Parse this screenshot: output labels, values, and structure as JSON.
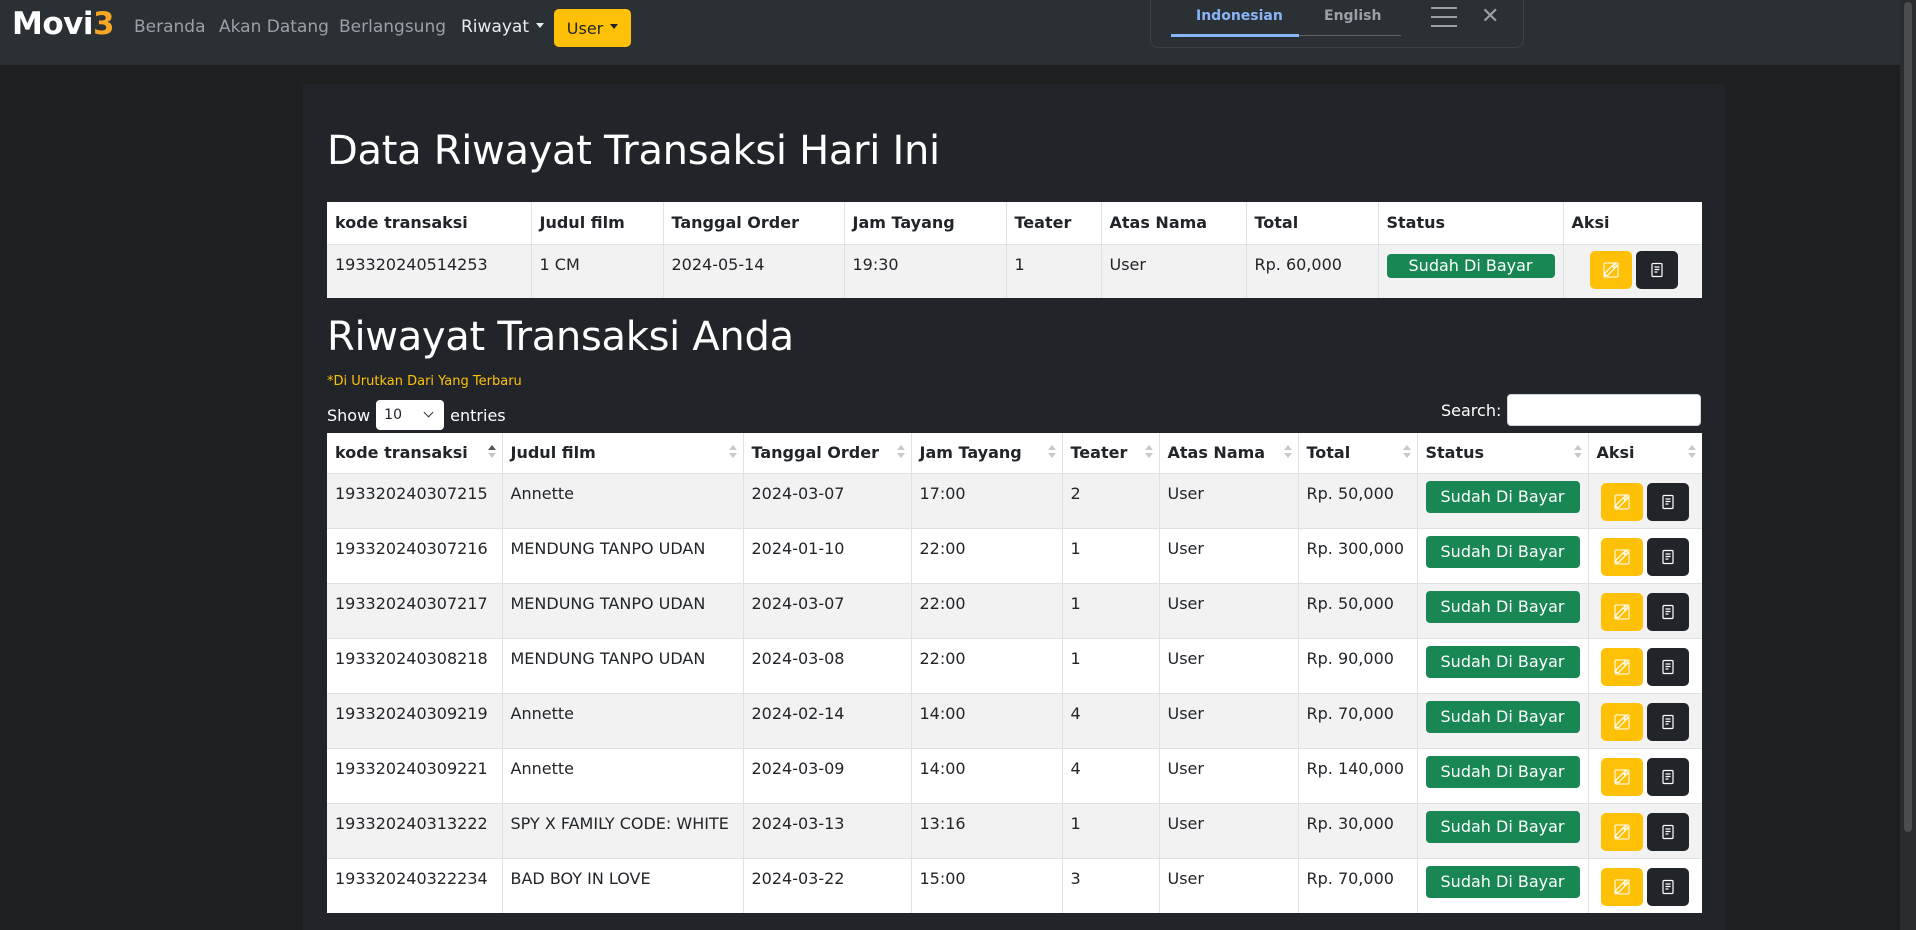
{
  "brand": {
    "name": "Movi",
    "accent": "3"
  },
  "nav": {
    "beranda": "Beranda",
    "akan_datang": "Akan Datang",
    "berlangsung": "Berlangsung",
    "riwayat": "Riwayat",
    "user": "User"
  },
  "lang": {
    "indonesian": "Indonesian",
    "english": "English"
  },
  "today": {
    "title": "Data Riwayat Transaksi Hari Ini",
    "headers": [
      "kode transaksi",
      "Judul film",
      "Tanggal Order",
      "Jam Tayang",
      "Teater",
      "Atas Nama",
      "Total",
      "Status",
      "Aksi"
    ],
    "rows": [
      [
        "193320240514253",
        "1 CM",
        "2024-05-14",
        "19:30",
        "1",
        "User",
        "Rp. 60,000",
        "Sudah Di Bayar"
      ]
    ]
  },
  "history": {
    "title": "Riwayat Transaksi Anda",
    "note": "*Di Urutkan Dari Yang Terbaru",
    "show_label": "Show",
    "entries_value": "10",
    "entries_label": "entries",
    "search_label": "Search:",
    "headers": [
      "kode transaksi",
      "Judul film",
      "Tanggal Order",
      "Jam Tayang",
      "Teater",
      "Atas Nama",
      "Total",
      "Status",
      "Aksi"
    ],
    "rows": [
      [
        "193320240307215",
        "Annette",
        "2024-03-07",
        "17:00",
        "2",
        "User",
        "Rp. 50,000",
        "Sudah Di Bayar"
      ],
      [
        "193320240307216",
        "MENDUNG TANPO UDAN",
        "2024-01-10",
        "22:00",
        "1",
        "User",
        "Rp. 300,000",
        "Sudah Di Bayar"
      ],
      [
        "193320240307217",
        "MENDUNG TANPO UDAN",
        "2024-03-07",
        "22:00",
        "1",
        "User",
        "Rp. 50,000",
        "Sudah Di Bayar"
      ],
      [
        "193320240308218",
        "MENDUNG TANPO UDAN",
        "2024-03-08",
        "22:00",
        "1",
        "User",
        "Rp. 90,000",
        "Sudah Di Bayar"
      ],
      [
        "193320240309219",
        "Annette",
        "2024-02-14",
        "14:00",
        "4",
        "User",
        "Rp. 70,000",
        "Sudah Di Bayar"
      ],
      [
        "193320240309221",
        "Annette",
        "2024-03-09",
        "14:00",
        "4",
        "User",
        "Rp. 140,000",
        "Sudah Di Bayar"
      ],
      [
        "193320240313222",
        "SPY X FAMILY CODE: WHITE",
        "2024-03-13",
        "13:16",
        "1",
        "User",
        "Rp. 30,000",
        "Sudah Di Bayar"
      ],
      [
        "193320240322234",
        "BAD BOY IN LOVE",
        "2024-03-22",
        "15:00",
        "3",
        "User",
        "Rp. 70,000",
        "Sudah Di Bayar"
      ]
    ]
  },
  "icons": {
    "edit": "edit-icon",
    "receipt": "receipt-icon",
    "menu": "menu-icon",
    "close": "close-icon"
  },
  "colors": {
    "accent": "#ffc107",
    "success": "#198754",
    "dark": "#212529",
    "lang_active": "#8ab4f8"
  }
}
